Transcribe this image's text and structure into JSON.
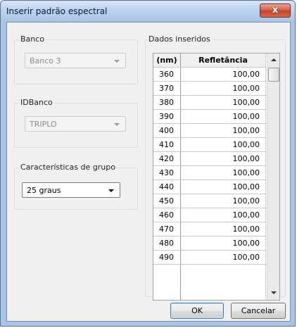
{
  "window": {
    "title": "Inserir padrão espectral",
    "close_glyph": "x"
  },
  "banco": {
    "label": "Banco",
    "value": "Banco 3"
  },
  "idbanco": {
    "label": "IDBanco",
    "value": "TRIPLO"
  },
  "grupo": {
    "label": "Características de grupo",
    "value": "25 graus"
  },
  "dados": {
    "label": "Dados inseridos",
    "col_nm": "(nm)",
    "col_refl": "Refletância",
    "rows": [
      {
        "nm": "360",
        "refl": "100,00"
      },
      {
        "nm": "370",
        "refl": "100,00"
      },
      {
        "nm": "380",
        "refl": "100,00"
      },
      {
        "nm": "390",
        "refl": "100,00"
      },
      {
        "nm": "400",
        "refl": "100,00"
      },
      {
        "nm": "410",
        "refl": "100,00"
      },
      {
        "nm": "420",
        "refl": "100,00"
      },
      {
        "nm": "430",
        "refl": "100,00"
      },
      {
        "nm": "440",
        "refl": "100,00"
      },
      {
        "nm": "450",
        "refl": "100,00"
      },
      {
        "nm": "460",
        "refl": "100,00"
      },
      {
        "nm": "470",
        "refl": "100,00"
      },
      {
        "nm": "480",
        "refl": "100,00"
      },
      {
        "nm": "490",
        "refl": "100,00"
      }
    ]
  },
  "buttons": {
    "ok": "OK",
    "cancel": "Cancelar"
  }
}
